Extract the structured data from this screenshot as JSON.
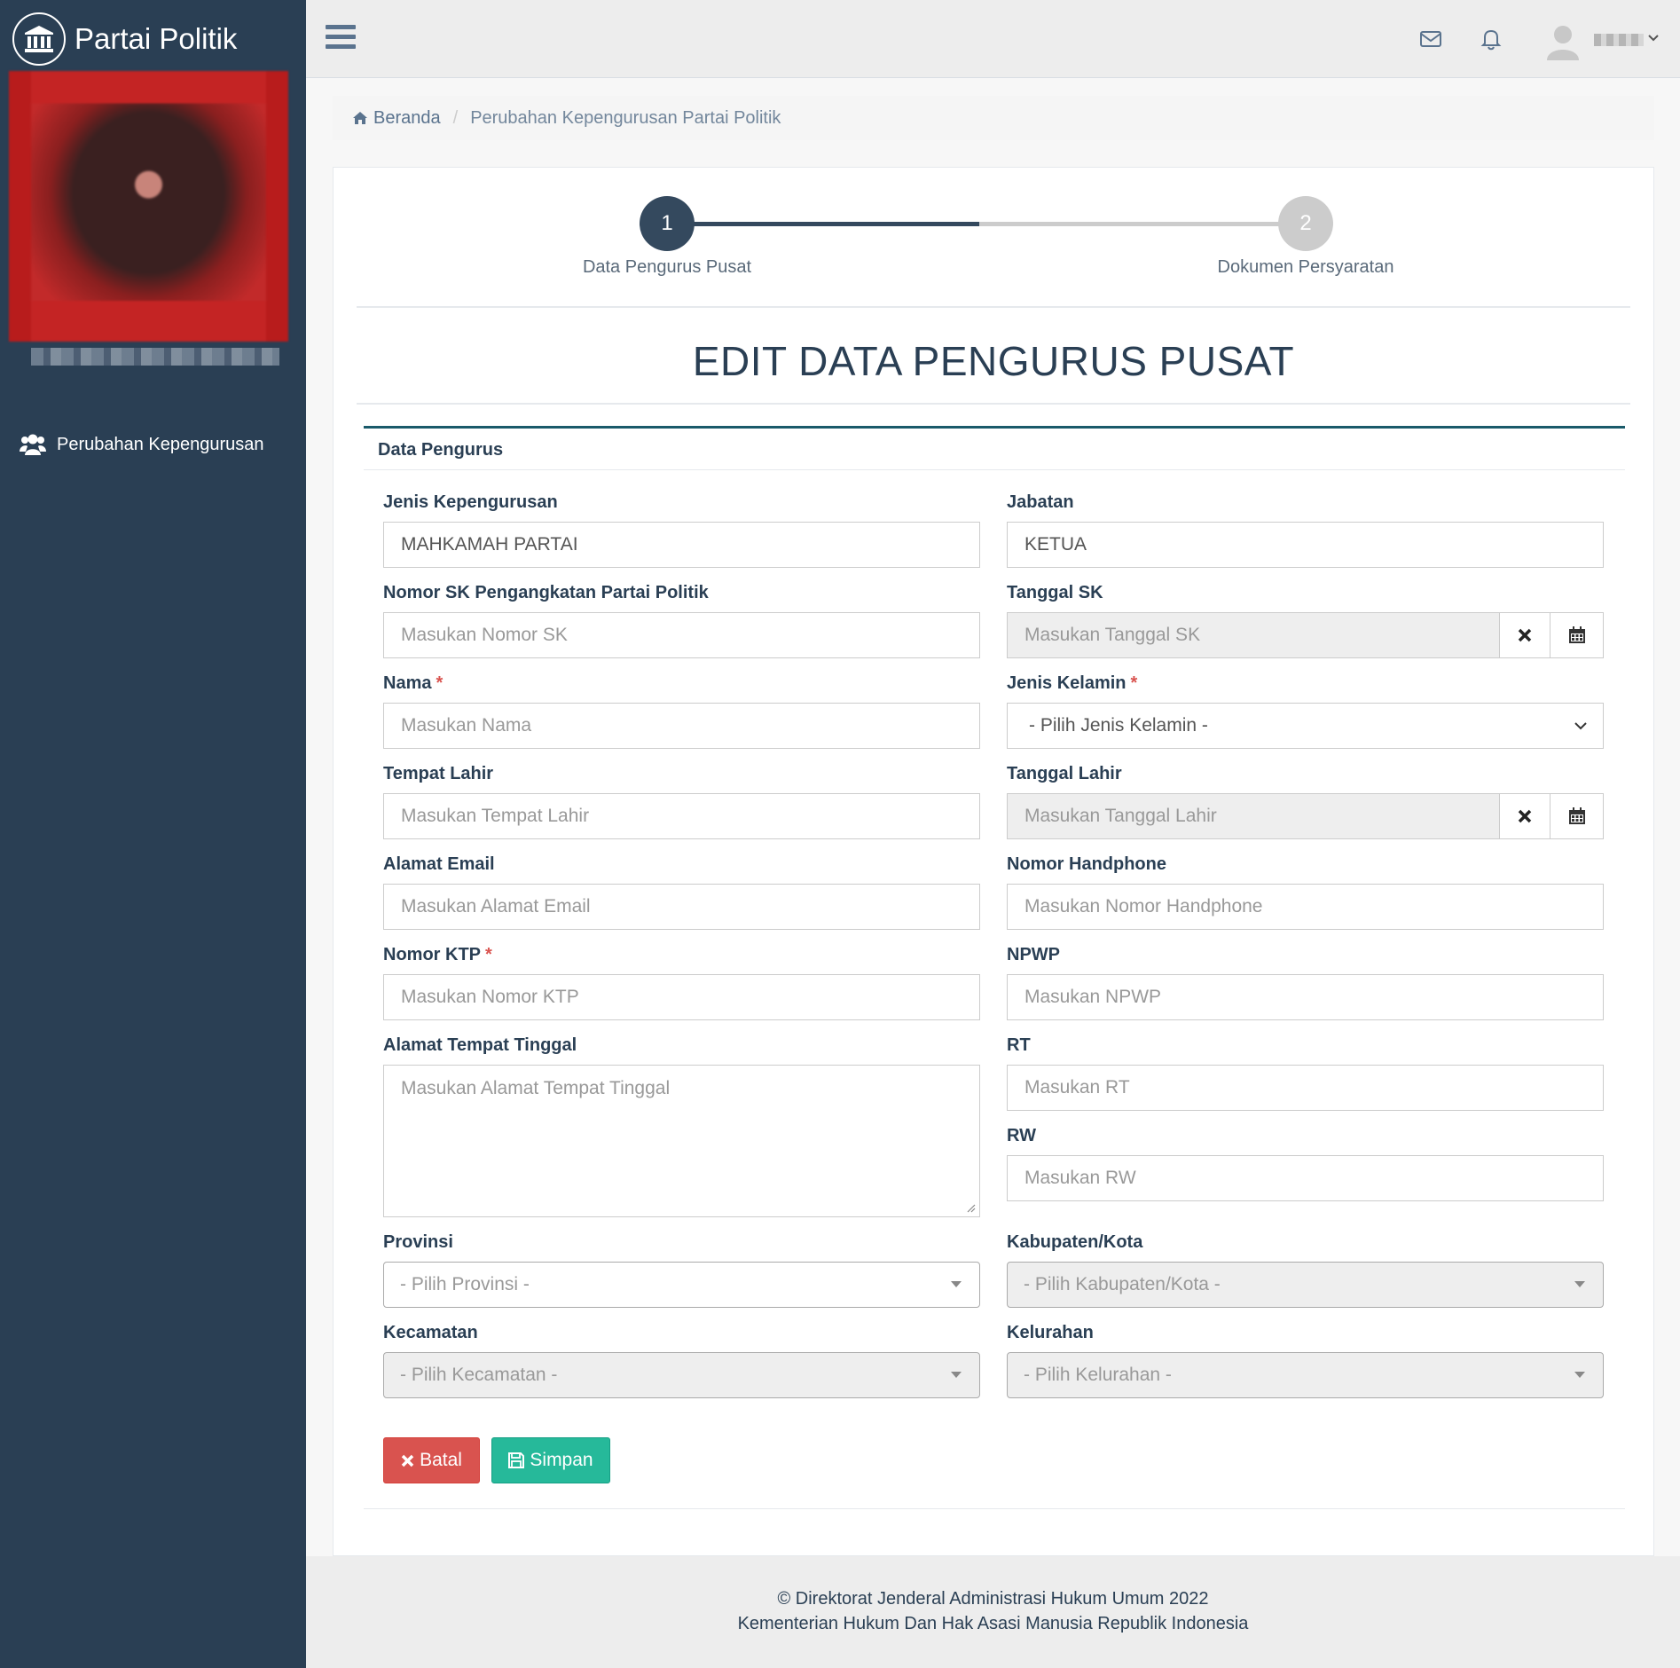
{
  "brand": {
    "title": "Partai Politik",
    "icon": "bank-icon"
  },
  "sidebar": {
    "items": [
      {
        "label": "Perubahan Kepengurusan",
        "icon": "users-icon"
      }
    ]
  },
  "topnav": {
    "icons": [
      "bars-icon",
      "envelope-icon",
      "bell-icon",
      "user-avatar"
    ]
  },
  "breadcrumb": {
    "home": "Beranda",
    "current": "Perubahan Kepengurusan Partai Politik"
  },
  "wizard": {
    "steps": [
      {
        "number": "1",
        "label": "Data Pengurus Pusat",
        "active": true
      },
      {
        "number": "2",
        "label": "Dokumen Persyaratan",
        "active": false
      }
    ]
  },
  "page": {
    "title": "EDIT DATA PENGURUS PUSAT",
    "section": "Data Pengurus"
  },
  "form": {
    "jenis_kepengurusan": {
      "label": "Jenis Kepengurusan",
      "value": "MAHKAMAH PARTAI"
    },
    "jabatan": {
      "label": "Jabatan",
      "value": "KETUA"
    },
    "nomor_sk": {
      "label": "Nomor SK Pengangkatan Partai Politik",
      "placeholder": "Masukan Nomor SK"
    },
    "tanggal_sk": {
      "label": "Tanggal SK",
      "placeholder": "Masukan Tanggal SK"
    },
    "nama": {
      "label": "Nama",
      "required": "*",
      "placeholder": "Masukan Nama"
    },
    "jenis_kelamin": {
      "label": "Jenis Kelamin",
      "required": "*",
      "selected": "- Pilih Jenis Kelamin -"
    },
    "tempat_lahir": {
      "label": "Tempat Lahir",
      "placeholder": "Masukan Tempat Lahir"
    },
    "tanggal_lahir": {
      "label": "Tanggal Lahir",
      "placeholder": "Masukan Tanggal Lahir"
    },
    "email": {
      "label": "Alamat Email",
      "placeholder": "Masukan Alamat Email"
    },
    "handphone": {
      "label": "Nomor Handphone",
      "placeholder": "Masukan Nomor Handphone"
    },
    "ktp": {
      "label": "Nomor KTP",
      "required": "*",
      "placeholder": "Masukan Nomor KTP"
    },
    "npwp": {
      "label": "NPWP",
      "placeholder": "Masukan NPWP"
    },
    "alamat": {
      "label": "Alamat Tempat Tinggal",
      "placeholder": "Masukan Alamat Tempat Tinggal"
    },
    "rt": {
      "label": "RT",
      "placeholder": "Masukan RT"
    },
    "rw": {
      "label": "RW",
      "placeholder": "Masukan RW"
    },
    "provinsi": {
      "label": "Provinsi",
      "selected": "- Pilih Provinsi -"
    },
    "kabupaten": {
      "label": "Kabupaten/Kota",
      "selected": "- Pilih Kabupaten/Kota -"
    },
    "kecamatan": {
      "label": "Kecamatan",
      "selected": "- Pilih Kecamatan -"
    },
    "kelurahan": {
      "label": "Kelurahan",
      "selected": "- Pilih Kelurahan -"
    }
  },
  "buttons": {
    "batal": "Batal",
    "simpan": "Simpan"
  },
  "footer": {
    "line1": "© Direktorat Jenderal Administrasi Hukum Umum 2022",
    "line2": "Kementerian Hukum Dan Hak Asasi Manusia Republik Indonesia"
  },
  "colors": {
    "sidebar": "#2a3f54",
    "accent": "#1a5a6a",
    "danger": "#d9534f",
    "success": "#26b99a",
    "required": "#d9534f"
  }
}
